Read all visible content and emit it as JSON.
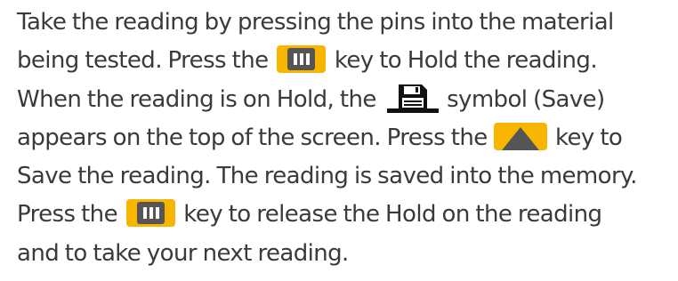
{
  "paragraph": {
    "line1": "Take the reading by pressing the pins into the material",
    "line2_before": "being tested. Press the ",
    "line2_after": " key to Hold the reading.",
    "line3_before": "When the reading is on Hold, the ",
    "line3_after": " symbol (Save)",
    "line4_before": "appears on the top of the screen. Press the ",
    "line4_after": " key to",
    "line5": "Save the reading. The reading is saved into the memory.",
    "line6_before": "Press the ",
    "line6_after": " key to release the Hold on the reading",
    "line7": "and to take your next reading."
  },
  "icons": {
    "hold_key": "hold-key-icon",
    "save_symbol": "floppy-disk-icon",
    "up_key": "up-arrow-key-icon"
  },
  "colors": {
    "text": "#3a3a3a",
    "key_yellow": "#f7b500",
    "key_dark": "#555555",
    "save_symbol": "#111111"
  }
}
